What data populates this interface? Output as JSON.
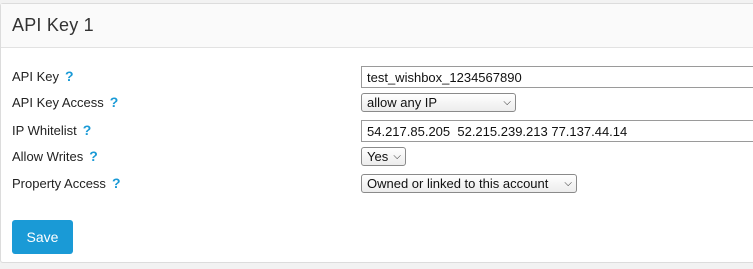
{
  "panel": {
    "title": "API Key 1"
  },
  "form": {
    "help_glyph": "?",
    "api_key": {
      "label": "API Key",
      "value": "test_wishbox_1234567890"
    },
    "api_key_access": {
      "label": "API Key Access",
      "selected": "allow any IP"
    },
    "ip_whitelist": {
      "label": "IP Whitelist",
      "value": "54.217.85.205  52.215.239.213 77.137.44.14"
    },
    "allow_writes": {
      "label": "Allow Writes",
      "selected": "Yes"
    },
    "property_access": {
      "label": "Property Access",
      "selected": "Owned or linked to this account"
    }
  },
  "actions": {
    "save_label": "Save"
  },
  "colors": {
    "accent": "#1a9ad6",
    "panel_bg": "#ffffff",
    "page_bg": "#f2f2f2"
  }
}
